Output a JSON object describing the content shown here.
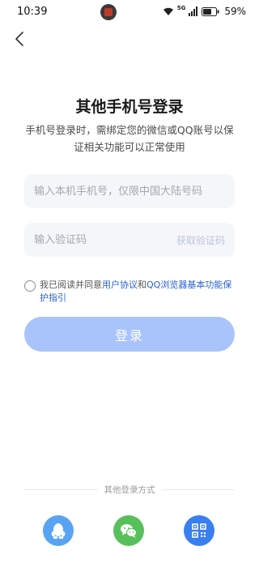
{
  "status_bar": {
    "time": "10:39",
    "network": "5G",
    "battery": "59%"
  },
  "login": {
    "title": "其他手机号登录",
    "subtitle": "手机号登录时，需绑定您的微信或QQ账号以保证相关功能可以正常使用",
    "phone_placeholder": "输入本机手机号，仅限中国大陆号码",
    "code_placeholder": "输入验证码",
    "get_code_label": "获取验证码",
    "agreement": {
      "prefix": "我已阅读并同意",
      "link1": "用户协议",
      "conjunction": "和",
      "link2": "QQ浏览器基本功能保护指引"
    },
    "login_button": "登录"
  },
  "other_login": {
    "label": "其他登录方式",
    "methods": [
      "qq",
      "wechat",
      "qrcode"
    ]
  },
  "colors": {
    "primary_disabled": "#a9c3fb",
    "link": "#2a5fd6",
    "qq": "#58a4f2",
    "wechat": "#58c05a",
    "qrcode": "#3a7ff0"
  }
}
